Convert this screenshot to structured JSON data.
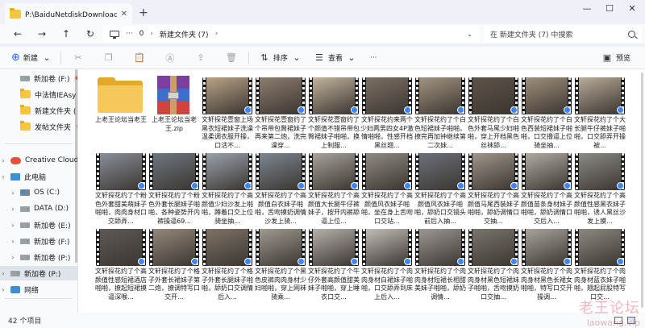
{
  "tab": {
    "title": "P:\\BaiduNetdiskDownload\\臨鑑",
    "close": "✕",
    "new": "+"
  },
  "window": {
    "minimize": "—",
    "maximize": "☐",
    "close": "✕"
  },
  "nav": {
    "back": "←",
    "forward": "→",
    "up": "↑",
    "refresh": "↻"
  },
  "address": {
    "more": "···",
    "segments": [
      "0",
      "新建文件夹 (7)"
    ],
    "separator": "›",
    "dropdown": "⌄"
  },
  "search": {
    "placeholder": "在 新建文件夹 (7) 中搜索"
  },
  "toolbar": {
    "new_label": "新建",
    "sort_label": "排序",
    "view_label": "查看",
    "more": "···",
    "preview_label": "预览"
  },
  "sidebar": {
    "items": [
      {
        "label": "新加卷 (F:)",
        "icon": "drive-icon",
        "pinned": true
      },
      {
        "label": "中法情IEAsy",
        "icon": "folder-icon",
        "pinned": true
      },
      {
        "label": "新建文件夹 (",
        "icon": "folder-icon",
        "pinned": true
      },
      {
        "label": "发帖文件夹",
        "icon": "folder-icon",
        "pinned": true
      },
      {
        "label": "Creative Cloud",
        "icon": "cloud-icon",
        "pinned": false
      },
      {
        "label": "此电脑",
        "icon": "pc-icon",
        "pinned": false
      },
      {
        "label": "OS (C:)",
        "icon": "win-drive-icon",
        "pinned": false
      },
      {
        "label": "DATA (D:)",
        "icon": "drive-icon",
        "pinned": false
      },
      {
        "label": "新加卷 (E:)",
        "icon": "drive-icon",
        "pinned": false
      },
      {
        "label": "新加卷 (F:)",
        "icon": "drive-icon",
        "pinned": false
      },
      {
        "label": "新加卷 (P:)",
        "icon": "drive-icon",
        "pinned": false
      },
      {
        "label": "新加卷 (P:)",
        "icon": "drive-icon",
        "pinned": false
      },
      {
        "label": "网络",
        "icon": "network-icon",
        "pinned": false
      }
    ]
  },
  "files": [
    {
      "name": "上老王论坛当老王",
      "kind": "folder"
    },
    {
      "name": "上老王论坛当老王.zip",
      "kind": "zip"
    },
    {
      "name": "文轩探花壹窗上场黑衣短裙妹子洗澡温柔调衣服开操，口活不...",
      "kind": "video",
      "tone": "#b9a387"
    },
    {
      "name": "文轩探花壹窗约了个吊带包臀裙妹子再来第二炮，洗完澡穿...",
      "kind": "video",
      "tone": "#8d7d6e"
    },
    {
      "name": "文轩探花壹窗约了个颜值不错吊带包臀裙妹子啪啪，换上制服...",
      "kind": "video",
      "tone": "#c2b39c"
    },
    {
      "name": "文轩探花约来两个少妇两男四女4P激情啪啪，性感开档黑丝翘...",
      "kind": "video",
      "tone": "#7b6f63"
    },
    {
      "name": "文轩探花约了个白色短裙妹子啪啪，撩完再加钟继续第二次妹...",
      "kind": "video",
      "tone": "#a39480"
    },
    {
      "name": "文轩探花约了个白色外套马尾少妇啪啪，穿上开档黑色丝袜舔...",
      "kind": "video",
      "tone": "#5e5348"
    },
    {
      "name": "文轩探花约了个白色西装短裙妹子啪啪，口交撸逼上位骑坐抽...",
      "kind": "video",
      "tone": "#9e8f7b"
    },
    {
      "name": "文轩探花约了个大长腿牛仔裤妹子啪啪，口交舔弄开操被...",
      "kind": "video",
      "tone": "#b8ab98"
    },
    {
      "name": "文轩探花约了个粉色外套甜美萌妹子啪啪，肉肉身材口交舔弄...",
      "kind": "video",
      "tone": "#8a8f9a"
    },
    {
      "name": "文轩探花约了个粉色外套长腿妹子啪啪，各种姿势开内裤操逼69...",
      "kind": "video",
      "tone": "#6f7680"
    },
    {
      "name": "文轩探花约了个高颜值少妇沙发上啪啪，蹲着口交上位骑坐抽...",
      "kind": "video",
      "tone": "#9aa2ad"
    },
    {
      "name": "文轩探花约了个高颜值白衣妹子啪啪，舌吻摸奶调情沙发上骑...",
      "kind": "video",
      "tone": "#7c8691"
    },
    {
      "name": "文轩探花约了个高颜值大长腿牛仔裤妹子，按开内裤舔逼上位...",
      "kind": "video",
      "tone": "#a7a39a"
    },
    {
      "name": "文轩探花约了个高颜值风衣妹子啪啪，坐在身上舌吻口交站...",
      "kind": "video",
      "tone": "#8f8a81"
    },
    {
      "name": "文轩探花约了个高颜值风衣妹子啪啪，舔奶口交镜头前后入抽...",
      "kind": "video",
      "tone": "#6c717a"
    },
    {
      "name": "文轩探花约了个高颜值马尾西装妹子啪啪，舔奶调情口交抽...",
      "kind": "video",
      "tone": "#a0968a"
    },
    {
      "name": "文轩探花约了个高颜值苗条身材妹子啪啪，舔奶调情口交后入...",
      "kind": "video",
      "tone": "#b0aba2"
    },
    {
      "name": "文轩探花约了个高颜值性感黑衣妹子啪啪，诱人黑丝沙发上摸...",
      "kind": "video",
      "tone": "#8d8a86"
    },
    {
      "name": "文轩探花约了个高颜值性感短裙酒店啪啪，撩起短裙摸逼深喉...",
      "kind": "video",
      "tone": "#5d5954"
    },
    {
      "name": "文轩探花约了个格子外套长裙妹子第二炮，撩调特写口交开...",
      "kind": "video",
      "tone": "#94887a"
    },
    {
      "name": "文轩探花约了个格子外套长腿妹子啪啪，舔奶口交调情后入...",
      "kind": "video",
      "tone": "#7d7366"
    },
    {
      "name": "文轩探花约了个黑色皮裤肉肉身材少妇啪啪，穿上网袜骑乘...",
      "kind": "video",
      "tone": "#a09a90"
    },
    {
      "name": "文轩探花约了个牛仔外套高颜值甜美妹子啪啪，穿上睡衣口交...",
      "kind": "video",
      "tone": "#b5b1ab"
    },
    {
      "name": "文轩探花约了个肉肉身材白裙妹子啪啪，口交舔弄到床上后入...",
      "kind": "video",
      "tone": "#c1bdb7"
    },
    {
      "name": "文轩探花约了个肉肉身材短裙长相甜美妹子啪啪，舔奶调情...",
      "kind": "video",
      "tone": "#9c9893"
    },
    {
      "name": "文轩探花约了个肉肉身材黑色短裙妹子啪啪，舌吻摸奶口交抽...",
      "kind": "video",
      "tone": "#7a746d"
    },
    {
      "name": "文轩探花约了个肉肉身材黑色长裙女啪啪，特写口交开操调...",
      "kind": "video",
      "tone": "#a8a39c"
    },
    {
      "name": "文轩探花约了个肉肉身材蓝衣妹子啪啪，翘起屁股特写口交...",
      "kind": "video",
      "tone": "#8e8881"
    }
  ],
  "status": {
    "count": "42 个项目"
  },
  "watermark": {
    "line1": "老王论坛",
    "line2": "laowang.vip"
  }
}
